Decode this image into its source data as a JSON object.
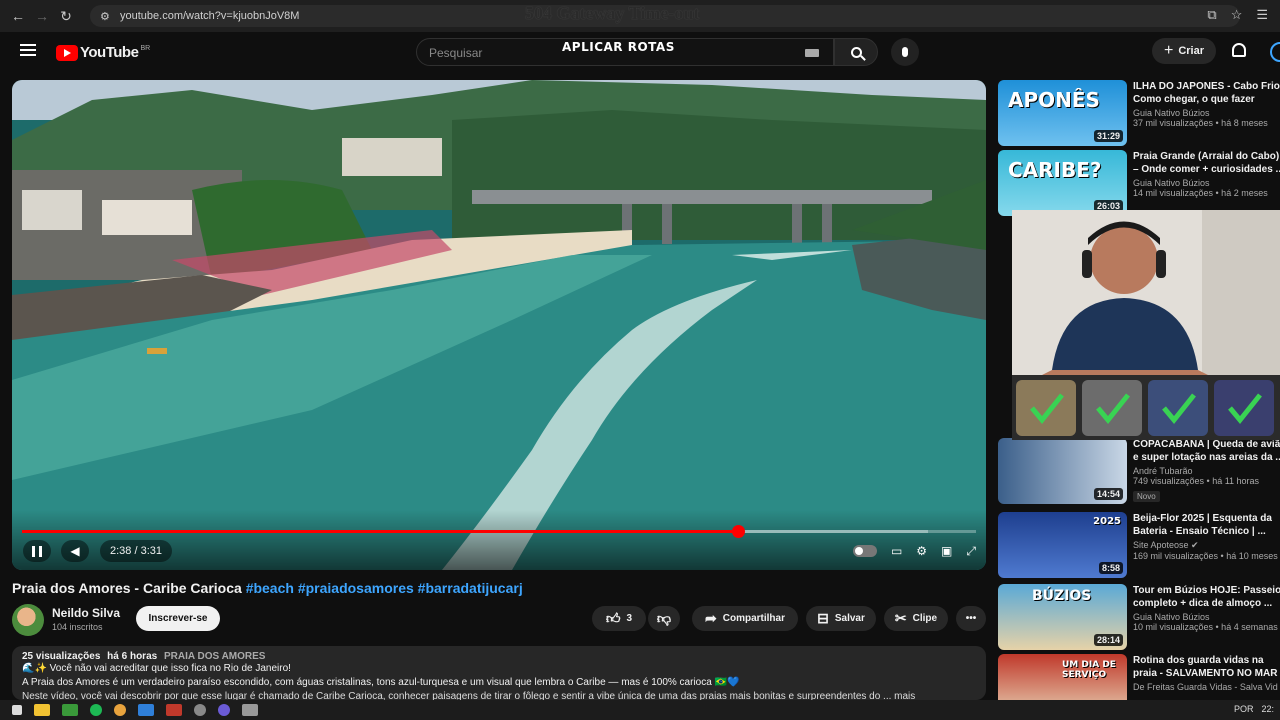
{
  "browser": {
    "url": "youtube.com/watch?v=kjuobnJoV8M",
    "overlay_title": "504 Gateway Time-out"
  },
  "header": {
    "logo_text": "YouTube",
    "country_code": "BR",
    "search_placeholder": "Pesquisar",
    "overlay_label": "APLICAR ROTAS",
    "create_label": "Criar"
  },
  "player": {
    "time": "2:38 / 3:31",
    "progress_fraction": 0.75,
    "loaded_fraction": 0.95
  },
  "video": {
    "title": "Praia dos Amores - Caribe Carioca",
    "hashtags": [
      "#beach",
      "#praiadosamores",
      "#barradatijucarj"
    ],
    "channel_name": "Neildo Silva",
    "subscribers": "104 inscritos",
    "subscribe_label": "Inscrever-se",
    "likes": "3",
    "share_label": "Compartilhar",
    "save_label": "Salvar",
    "clip_label": "Clipe",
    "views": "25 visualizações",
    "age": "há 6 horas",
    "desc_tag": "PRAIA DOS AMORES",
    "desc_line1": "🌊✨ Você não vai acreditar que isso fica no Rio de Janeiro!",
    "desc_line2": "A Praia dos Amores é um verdadeiro paraíso escondido, com águas cristalinas, tons azul-turquesa e um visual que lembra o Caribe — mas é 100% carioca 🇧🇷💙",
    "desc_line3": "Neste vídeo, você vai descobrir por que esse lugar é chamado de Caribe Carioca, conhecer paisagens de tirar o fôlego e sentir a vibe única de uma das praias mais bonitas e surpreendentes do ... mais"
  },
  "sidebar": {
    "items": [
      {
        "title": "ILHA DO JAPONES - Cabo Frio",
        "title2": "Como chegar, o que fazer",
        "channel": "Guia Nativo Búzios",
        "views": "37 mil visualizações • há 8 meses",
        "duration": "31:29",
        "thumb_text": "APONÊS"
      },
      {
        "title": "Praia Grande (Arraial do Cabo)",
        "title2": "– Onde comer + curiosidades ...",
        "channel": "Guia Nativo Búzios",
        "views": "14 mil visualizações • há 2 meses",
        "duration": "26:03",
        "thumb_text": "CARIBE?"
      },
      {
        "title": "COPACABANA | Queda de aviã",
        "title2": "e super lotação nas areias da ...",
        "channel": "André Tubarão",
        "views": "749 visualizações • há 11 horas",
        "duration": "14:54",
        "badge": "Novo"
      },
      {
        "title": "Beija-Flor 2025 | Esquenta da",
        "title2": "Bateria - Ensaio Técnico | ...",
        "channel": "Site Apoteose ✔",
        "views": "169 mil visualizações • há 10 meses",
        "duration": "8:58",
        "thumb_text": "2025"
      },
      {
        "title": "Tour em Búzios HOJE: Passeio",
        "title2": "completo + dica de almoço ...",
        "channel": "Guia Nativo Búzios",
        "views": "10 mil visualizações • há 4 semanas",
        "duration": "28:14",
        "thumb_text": "BÚZIOS"
      },
      {
        "title": "Rotina dos guarda vidas na",
        "title2": "praia - SALVAMENTO NO MAR",
        "channel": "De Freitas Guarda Vidas - Salva Vid",
        "views": "",
        "duration": "",
        "thumb_text": "UM DIA DE SERVIÇO"
      }
    ]
  },
  "taskbar": {
    "lang": "POR",
    "clock": "22:"
  },
  "colors": {
    "accent_red": "#ff0000",
    "link_blue": "#3ea6ff",
    "background": "#0f0f0f"
  }
}
